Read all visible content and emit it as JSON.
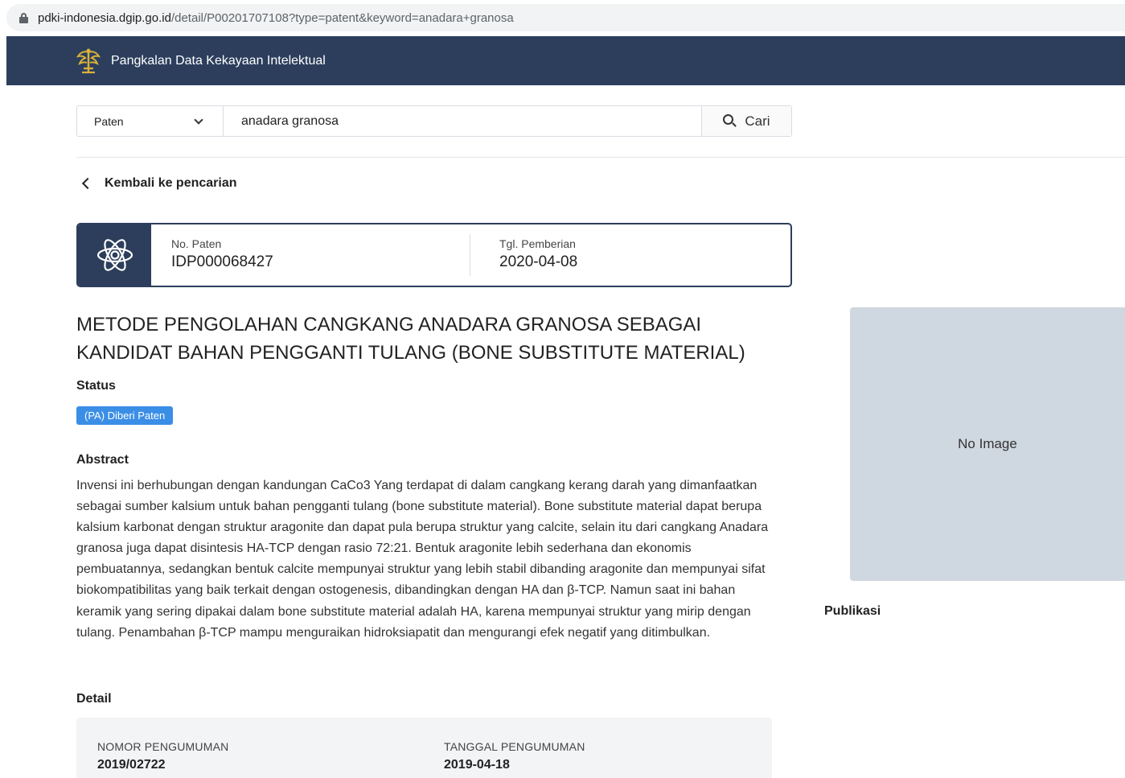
{
  "browser": {
    "url_host": "pdki-indonesia.dgip.go.id",
    "url_path": "/detail/P00201707108?type=patent&keyword=anadara+granosa"
  },
  "header": {
    "brand": "Pangkalan Data Kekayaan Intelektual"
  },
  "search": {
    "type_selected": "Paten",
    "query": "anadara granosa",
    "button_label": "Cari"
  },
  "nav": {
    "back_label": "Kembali ke pencarian"
  },
  "card": {
    "patent_no_label": "No. Paten",
    "patent_no_value": "IDP000068427",
    "grant_date_label": "Tgl. Pemberian",
    "grant_date_value": "2020-04-08"
  },
  "title": "METODE PENGOLAHAN CANGKANG ANADARA GRANOSA SEBAGAI KANDIDAT BAHAN PENGGANTI TULANG (BONE SUBSTITUTE MATERIAL)",
  "status": {
    "heading": "Status",
    "badge": "(PA) Diberi Paten",
    "badge_color": "#3b8ee6"
  },
  "abstract": {
    "heading": "Abstract",
    "text": "Invensi ini berhubungan dengan kandungan CaCo3 Yang terdapat di dalam cangkang kerang darah yang dimanfaatkan sebagai sumber kalsium untuk bahan pengganti tulang (bone substitute material). Bone substitute material dapat berupa kalsium karbonat dengan struktur aragonite dan dapat pula berupa struktur yang calcite, selain itu dari cangkang Anadara granosa juga dapat disintesis HA-TCP dengan rasio 72:21. Bentuk aragonite lebih sederhana dan ekonomis pembuatannya, sedangkan bentuk calcite mempunyai struktur yang lebih stabil dibanding aragonite dan mempunyai sifat biokompatibilitas yang baik terkait dengan ostogenesis, dibandingkan dengan HA dan β-TCP. Namun saat ini bahan keramik yang sering dipakai dalam bone substitute material adalah HA, karena mempunyai struktur yang mirip dengan tulang. Penambahan β-TCP mampu menguraikan hidroksiapatit dan mengurangi efek negatif yang ditimbulkan."
  },
  "detail": {
    "heading": "Detail",
    "fields": [
      {
        "label": "NOMOR PENGUMUMAN",
        "value": "2019/02722"
      },
      {
        "label": "TANGGAL PENGUMUMAN",
        "value": "2019-04-18"
      }
    ]
  },
  "sidebar": {
    "no_image_label": "No Image",
    "publikasi_heading": "Publikasi"
  },
  "colors": {
    "header_bg": "#2c3e5c",
    "logo_gold": "#d8b13a"
  }
}
